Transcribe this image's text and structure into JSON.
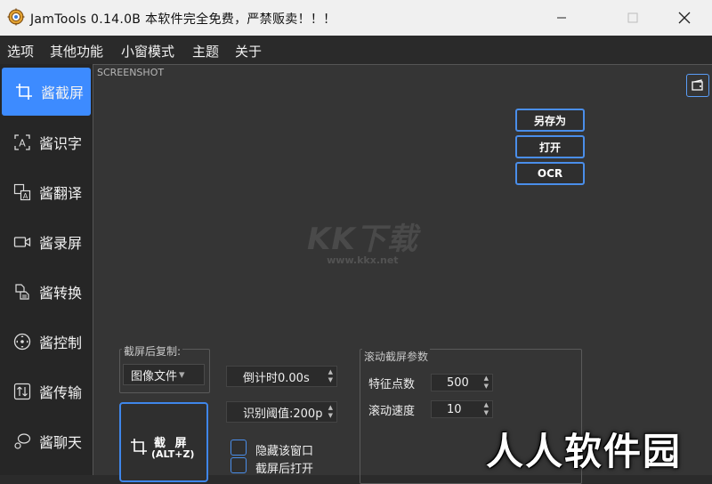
{
  "window": {
    "title": "JamTools 0.14.0B  本软件完全免费，严禁贩卖！！！",
    "app_icon": "gear-flower-icon"
  },
  "menu": {
    "items": [
      "选项",
      "其他功能",
      "小窗模式",
      "主题",
      "关于"
    ]
  },
  "sidebar": {
    "items": [
      {
        "label": "酱截屏",
        "icon": "crop-icon",
        "active": true
      },
      {
        "label": "酱识字",
        "icon": "text-recognize-icon",
        "active": false
      },
      {
        "label": "酱翻译",
        "icon": "translate-icon",
        "active": false
      },
      {
        "label": "酱录屏",
        "icon": "video-camera-icon",
        "active": false
      },
      {
        "label": "酱转换",
        "icon": "file-convert-icon",
        "active": false
      },
      {
        "label": "酱控制",
        "icon": "control-icon",
        "active": false
      },
      {
        "label": "酱传输",
        "icon": "transfer-icon",
        "active": false
      },
      {
        "label": "酱聊天",
        "icon": "chat-icon",
        "active": false
      }
    ]
  },
  "main": {
    "section_label": "SCREENSHOT",
    "actions": {
      "save_as": "另存为",
      "open": "打开",
      "ocr": "OCR"
    },
    "watermark": {
      "logo": "KK下载",
      "url": "www.kkx.net"
    },
    "copy_group": {
      "title": "截屏后复制:",
      "selected": "图像文件",
      "arrow": "▾"
    },
    "countdown": {
      "label": "倒计时0.00s"
    },
    "threshold": {
      "label": "识别阈值:200p"
    },
    "capture_button": {
      "label": "截 屏",
      "shortcut": "(ALT+Z)"
    },
    "checkboxes": [
      {
        "label": "隐藏该窗口",
        "checked": false
      },
      {
        "label": "截屏后打开",
        "checked": false
      }
    ],
    "scroll_group": {
      "title": "滚动截屏参数",
      "feature_points": {
        "label": "特征点数",
        "value": "500"
      },
      "scroll_speed": {
        "label": "滚动速度",
        "value": "10"
      }
    }
  },
  "overlay_watermark": "人人软件园",
  "colors": {
    "accent": "#3d8bff",
    "border_accent": "#4a8eea",
    "background": "#353535",
    "sidebar": "#262626"
  }
}
